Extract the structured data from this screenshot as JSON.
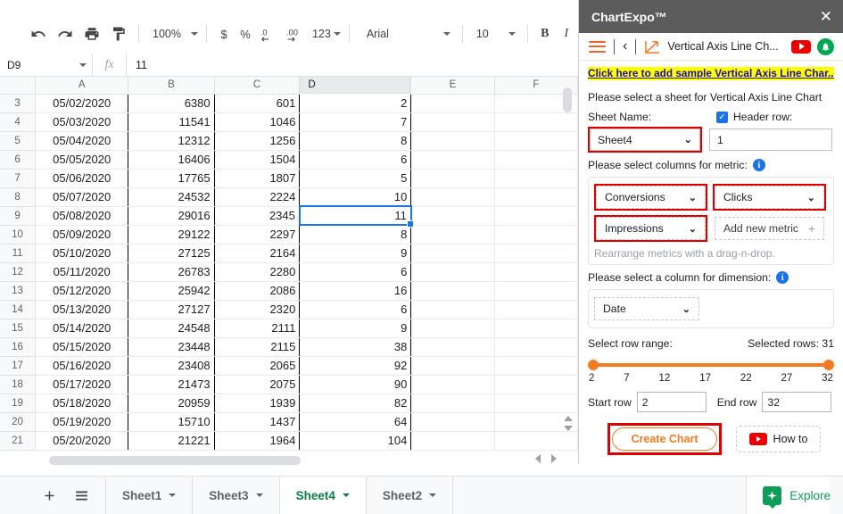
{
  "toolbar": {
    "undo": "undo-icon",
    "redo": "redo-icon",
    "print": "print-icon",
    "paint": "paint-format-icon",
    "zoom": "100%",
    "currency": "$",
    "percent": "%",
    "dec_decrease": ".0",
    "dec_increase": ".00",
    "formats": "123",
    "font": "Arial",
    "font_size": "10",
    "bold": "B",
    "italic": "I",
    "more": "▸"
  },
  "formula_bar": {
    "name_box": "D9",
    "fx": "fx",
    "value": "11"
  },
  "grid": {
    "columns": [
      "A",
      "B",
      "C",
      "D",
      "E",
      "F"
    ],
    "selected_column": "D",
    "selected_cell": "D9",
    "rows": [
      {
        "n": "3",
        "a": "05/02/2020",
        "b": "6380",
        "c": "601",
        "d": "2"
      },
      {
        "n": "4",
        "a": "05/03/2020",
        "b": "11541",
        "c": "1046",
        "d": "7"
      },
      {
        "n": "5",
        "a": "05/04/2020",
        "b": "12312",
        "c": "1256",
        "d": "8"
      },
      {
        "n": "6",
        "a": "05/05/2020",
        "b": "16406",
        "c": "1504",
        "d": "6"
      },
      {
        "n": "7",
        "a": "05/06/2020",
        "b": "17765",
        "c": "1807",
        "d": "5"
      },
      {
        "n": "8",
        "a": "05/07/2020",
        "b": "24532",
        "c": "2224",
        "d": "10"
      },
      {
        "n": "9",
        "a": "05/08/2020",
        "b": "29016",
        "c": "2345",
        "d": "11"
      },
      {
        "n": "10",
        "a": "05/09/2020",
        "b": "29122",
        "c": "2297",
        "d": "8"
      },
      {
        "n": "11",
        "a": "05/10/2020",
        "b": "27125",
        "c": "2164",
        "d": "9"
      },
      {
        "n": "12",
        "a": "05/11/2020",
        "b": "26783",
        "c": "2280",
        "d": "6"
      },
      {
        "n": "13",
        "a": "05/12/2020",
        "b": "25942",
        "c": "2086",
        "d": "16"
      },
      {
        "n": "14",
        "a": "05/13/2020",
        "b": "27127",
        "c": "2320",
        "d": "6"
      },
      {
        "n": "15",
        "a": "05/14/2020",
        "b": "24548",
        "c": "2111",
        "d": "9"
      },
      {
        "n": "16",
        "a": "05/15/2020",
        "b": "23448",
        "c": "2115",
        "d": "38"
      },
      {
        "n": "17",
        "a": "05/16/2020",
        "b": "23408",
        "c": "2065",
        "d": "92"
      },
      {
        "n": "18",
        "a": "05/17/2020",
        "b": "21473",
        "c": "2075",
        "d": "90"
      },
      {
        "n": "19",
        "a": "05/18/2020",
        "b": "20959",
        "c": "1939",
        "d": "82"
      },
      {
        "n": "20",
        "a": "05/19/2020",
        "b": "15710",
        "c": "1437",
        "d": "64"
      },
      {
        "n": "21",
        "a": "05/20/2020",
        "b": "21221",
        "c": "1964",
        "d": "104"
      }
    ]
  },
  "tabbar": {
    "add": "+",
    "all_sheets": "all-sheets-icon",
    "tabs": [
      {
        "label": "Sheet1",
        "active": false
      },
      {
        "label": "Sheet3",
        "active": false
      },
      {
        "label": "Sheet4",
        "active": true
      },
      {
        "label": "Sheet2",
        "active": false
      }
    ],
    "explore": "Explore"
  },
  "panel": {
    "title": "ChartExpo™",
    "close": "✕",
    "menu_icon": "hamburger-icon",
    "back_icon": "‹",
    "chart_icon": "line-chart-icon",
    "chart_name": "Vertical Axis Line Ch...",
    "youtube_icon": "youtube-icon",
    "bell_icon": "•",
    "sample_link": "Click here to add sample Vertical Axis Line Char...",
    "select_sheet_text": "Please select a sheet for Vertical Axis Line Chart",
    "sheet_name_label": "Sheet Name:",
    "sheet_name_value": "Sheet4",
    "header_row_label": "Header row:",
    "header_row_value": "1",
    "metric_label": "Please select columns for metric:",
    "metrics": [
      {
        "label": "Conversions",
        "highlighted": true
      },
      {
        "label": "Clicks",
        "highlighted": true
      },
      {
        "label": "Impressions",
        "highlighted": true
      }
    ],
    "add_metric_label": "Add new metric",
    "add_metric_plus": "+",
    "rearrange_hint": "Rearrange metrics with a drag-n-drop.",
    "dimension_label": "Please select a column for dimension:",
    "dimension_value": "Date",
    "row_range_label": "Select row range:",
    "selected_rows_label": "Selected rows: 31",
    "slider_ticks": [
      "2",
      "7",
      "12",
      "17",
      "22",
      "27",
      "32"
    ],
    "start_row_label": "Start row",
    "start_row_value": "2",
    "end_row_label": "End row",
    "end_row_value": "32",
    "create_chart_label": "Create Chart",
    "how_to_label": "How to"
  },
  "colors": {
    "accent_orange": "#f47b20",
    "highlight_red": "#e00000",
    "link_blue": "#1a0dab",
    "highlight_yellow": "#ffff00",
    "sheets_green": "#0f9d58"
  }
}
